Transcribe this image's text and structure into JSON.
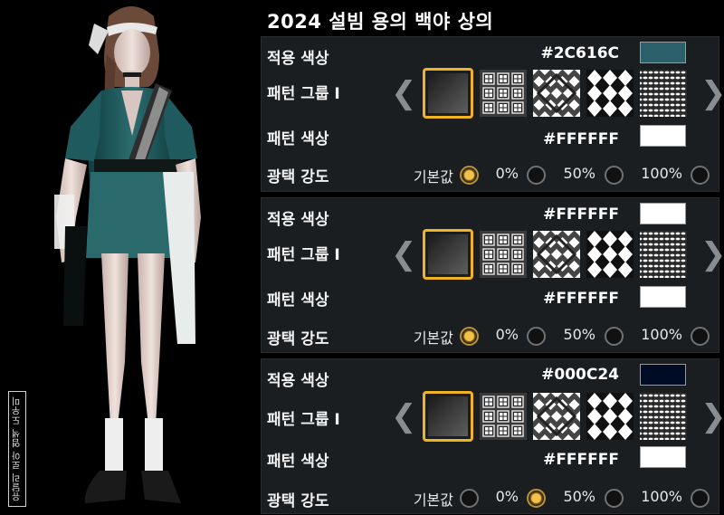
{
  "title": "2024 설빔 용의 백야 상의",
  "watermark": "유달리 로아 염색 도우미",
  "labels": {
    "apply_color": "적용 색상",
    "pattern_group": "패턴 그룹 Ⅰ",
    "pattern_color": "패턴 색상",
    "gloss": "광택 강도"
  },
  "gloss_options": [
    "기본값",
    "0%",
    "50%",
    "100%"
  ],
  "nav": {
    "prev": "❮",
    "next": "❯"
  },
  "pattern_icons": [
    "gradient-pattern-icon",
    "window-grid-pattern-icon",
    "diamond-lattice-pattern-icon",
    "argyle-pattern-icon",
    "dotted-wave-pattern-icon"
  ],
  "sections": [
    {
      "apply_hex": "#2C616C",
      "apply_color": "#2C616C",
      "pattern_hex": "#FFFFFF",
      "pattern_color": "#FFFFFF",
      "selected_pattern": 0,
      "selected_gloss": "기본값"
    },
    {
      "apply_hex": "#FFFFFF",
      "apply_color": "#FFFFFF",
      "pattern_hex": "#FFFFFF",
      "pattern_color": "#FFFFFF",
      "selected_pattern": 0,
      "selected_gloss": "기본값"
    },
    {
      "apply_hex": "#000C24",
      "apply_color": "#000C24",
      "pattern_hex": "#FFFFFF",
      "pattern_color": "#FFFFFF",
      "selected_pattern": 0,
      "selected_gloss": "0%"
    }
  ],
  "colors": {
    "accent_selected": "#f0b323",
    "panel_bg": "#1b1e21"
  }
}
